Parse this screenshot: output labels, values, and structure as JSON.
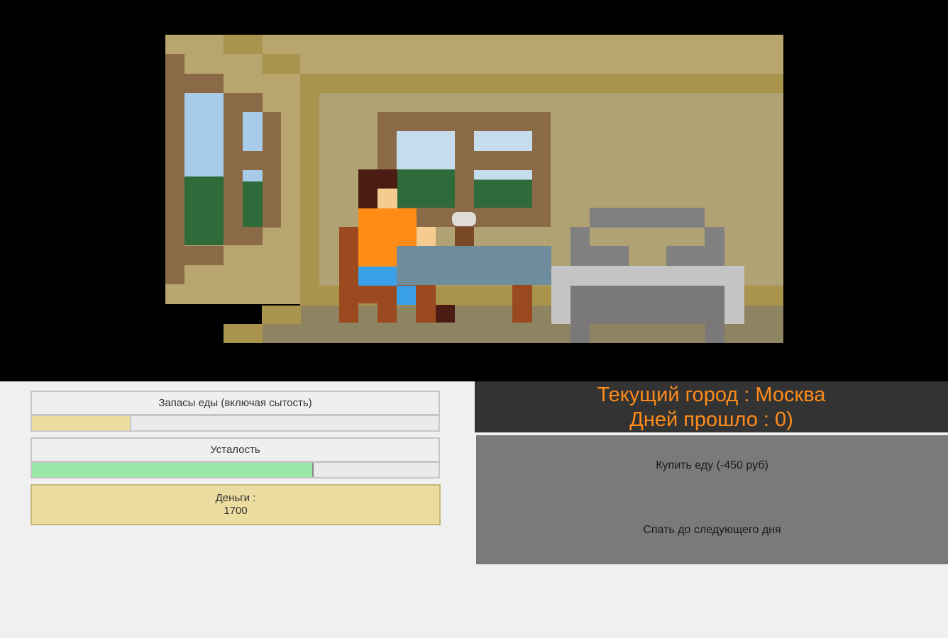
{
  "stats": {
    "food_label": "Запасы еды (включая сытость)",
    "food_level_percent": 24,
    "fatigue_label": "Усталость",
    "fatigue_level_percent": 69,
    "money_label": "Деньги :",
    "money_value": "1700"
  },
  "location": {
    "city_line": "Текущий город : Москва",
    "days_line": "Дней прошло : 0)"
  },
  "actions": {
    "buy_food_label": "Купить еду (-450 руб)",
    "sleep_label": "Спать до следующего дня"
  },
  "colors": {
    "food_bar": "#ebdca0",
    "fatigue_bar": "#98e8a8",
    "header_text": "#ff8c1a",
    "header_bg": "#333333",
    "actions_bg": "#7a7a7a"
  },
  "scene": {
    "character_icon": "pixel-person-icon",
    "cup_icon": "steaming-cup-icon",
    "bed_icon": "bed-icon"
  }
}
